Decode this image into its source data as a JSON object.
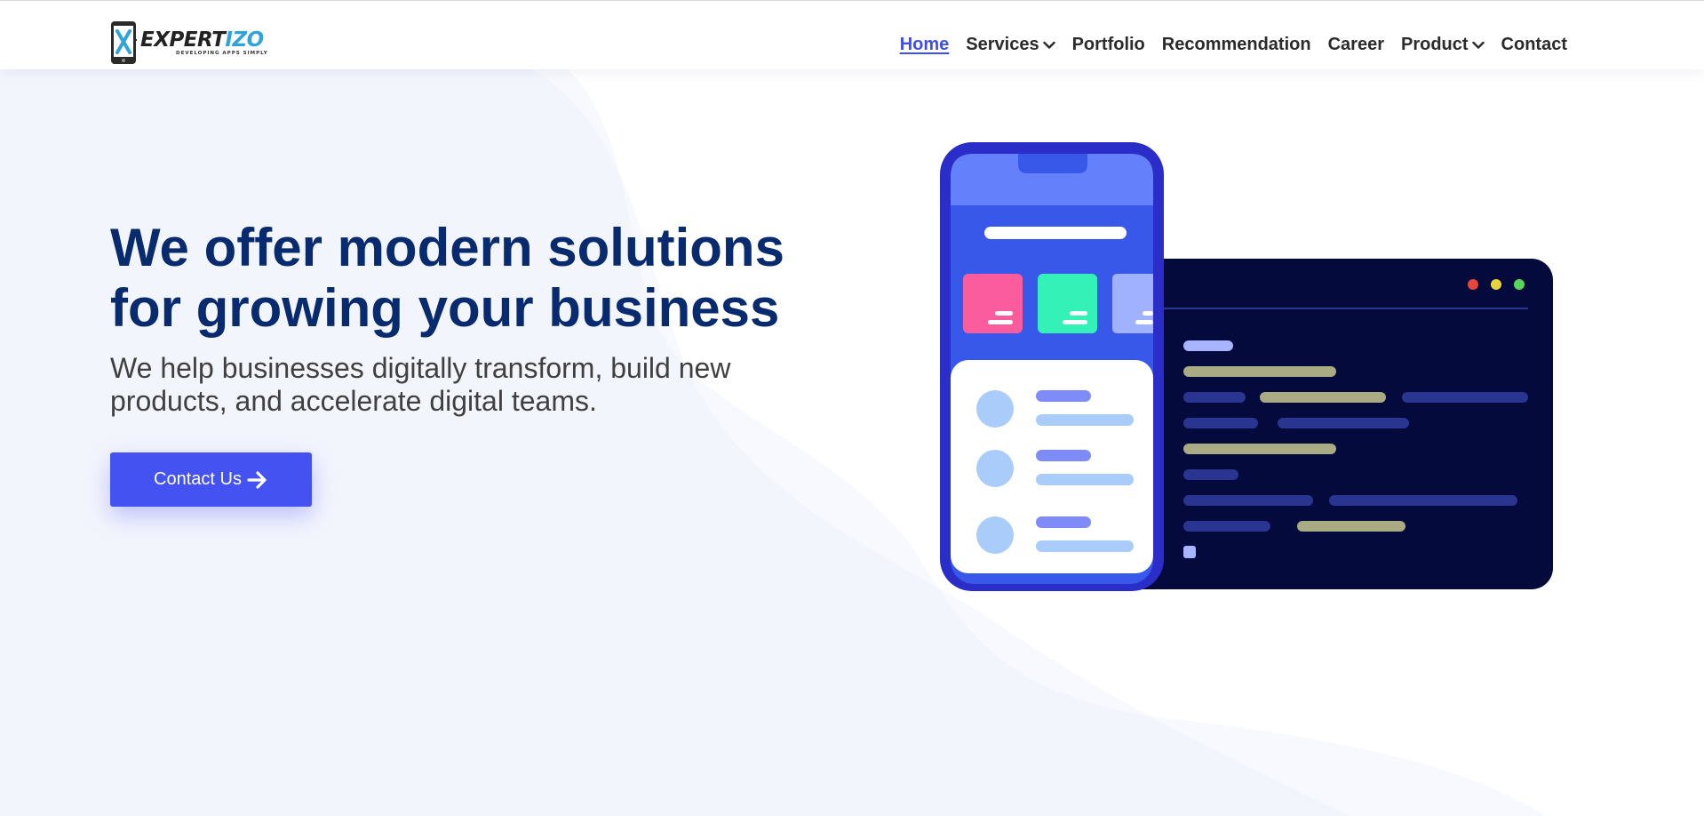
{
  "brand": {
    "logo_main": "EXPERT",
    "logo_accent": "IZO",
    "tagline": "DEVELOPING APPS SIMPLY",
    "accent_color": "#2ea3dc"
  },
  "nav": {
    "items": [
      {
        "label": "Home",
        "active": true,
        "dropdown": false
      },
      {
        "label": "Services",
        "active": false,
        "dropdown": true
      },
      {
        "label": "Portfolio",
        "active": false,
        "dropdown": false
      },
      {
        "label": "Recommendation",
        "active": false,
        "dropdown": false
      },
      {
        "label": "Career",
        "active": false,
        "dropdown": false
      },
      {
        "label": "Product",
        "active": false,
        "dropdown": true
      },
      {
        "label": "Contact",
        "active": false,
        "dropdown": false
      }
    ],
    "active_color": "#3e4cf0"
  },
  "hero": {
    "title_line1": "We offer modern solutions",
    "title_line2": "for growing your business",
    "subtitle_line1": "We help businesses digitally transform, build new",
    "subtitle_line2": "products, and accelerate digital teams.",
    "cta_label": "Contact Us",
    "cta_icon": "arrow-right-icon",
    "title_color": "#082a6e",
    "cta_color": "#4452f2"
  },
  "illustration": {
    "icons": [
      "phone-mockup-icon",
      "code-window-icon"
    ],
    "window_dots": [
      "#e8453c",
      "#e8d53c",
      "#59d65a"
    ]
  }
}
